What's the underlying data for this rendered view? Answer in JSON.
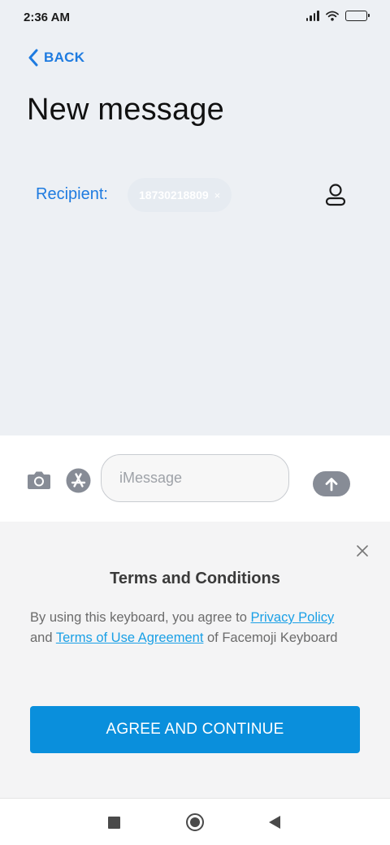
{
  "status_bar": {
    "time": "2:36 AM"
  },
  "header": {
    "back_label": "BACK",
    "title": "New message"
  },
  "recipient": {
    "label": "Recipient:",
    "number": "18730218809",
    "remove_symbol": "×"
  },
  "composer": {
    "placeholder": "iMessage"
  },
  "terms": {
    "title": "Terms and Conditions",
    "text_before": "By using this keyboard, you agree to ",
    "privacy_link": "Privacy Policy",
    "text_and": " and ",
    "terms_link": "Terms of Use Agreement",
    "text_after": " of Facemoji Keyboard",
    "agree_label": "AGREE AND CONTINUE"
  },
  "icons": {
    "status": [
      "signal-icon",
      "wifi-icon",
      "battery-icon"
    ],
    "composer": [
      "camera-icon",
      "appstore-icon",
      "send-arrow-icon"
    ],
    "navigation": [
      "recent-apps-icon",
      "home-icon",
      "back-triangle-icon"
    ]
  },
  "colors": {
    "accent": "#1e7be0",
    "link": "#1aa0e6",
    "agree_button": "#0a8fdc",
    "top_background": "#edf0f4",
    "send_button": "#878c96"
  }
}
